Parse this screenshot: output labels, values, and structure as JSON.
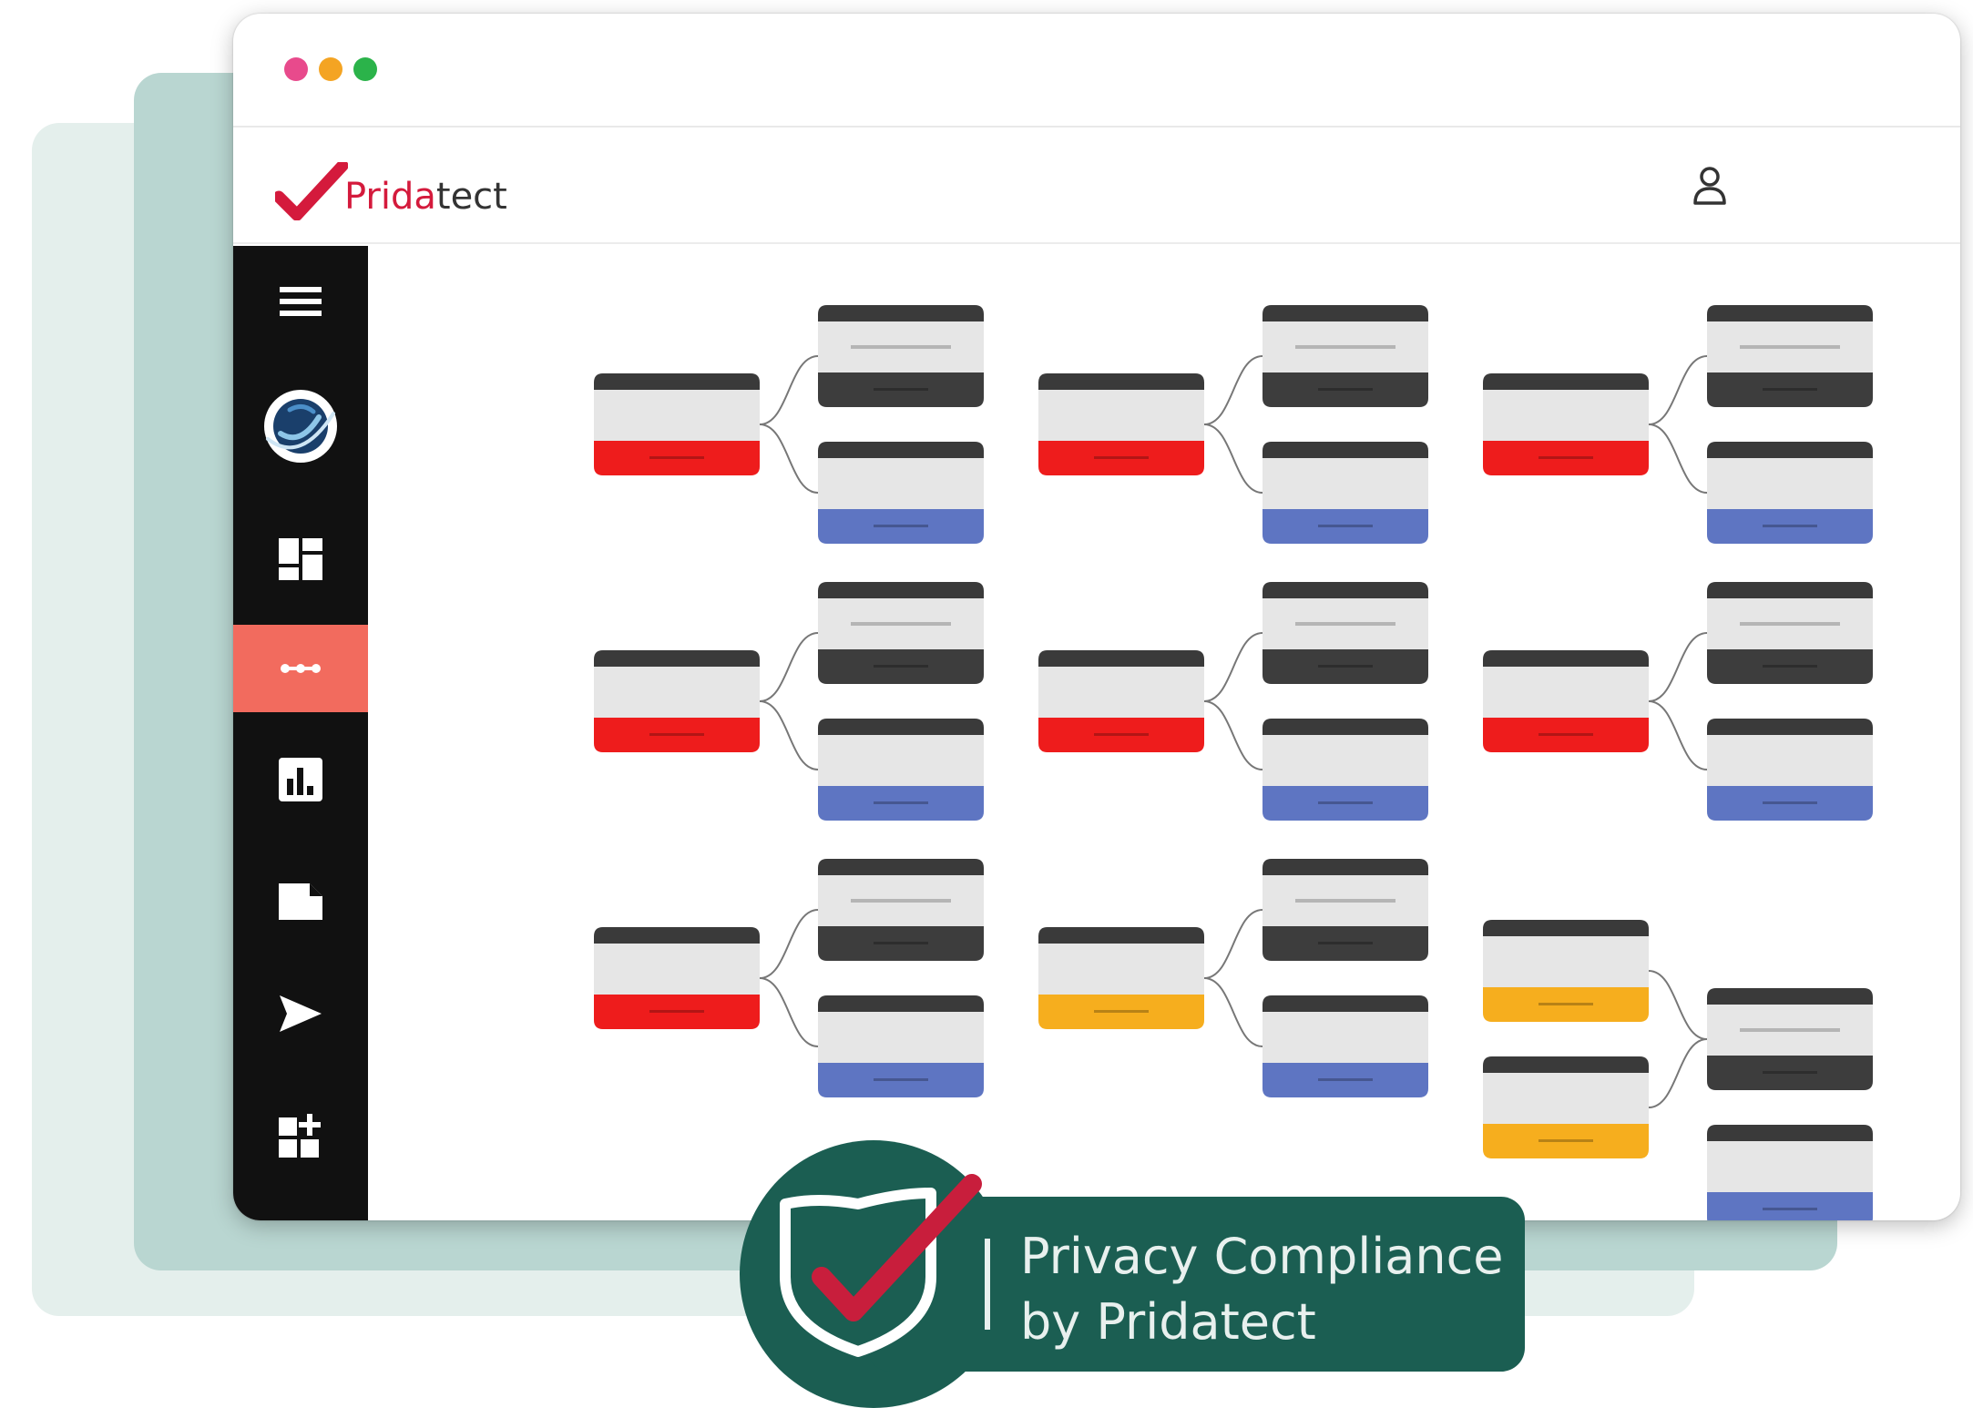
{
  "window": {
    "traffic_lights": [
      "#e84a8c",
      "#f4a423",
      "#2bb34a"
    ]
  },
  "app": {
    "logo_primary": "Prida",
    "logo_secondary": "tect",
    "user_icon": "user-icon",
    "brand_color": "#d41a3c"
  },
  "sidebar": {
    "items": [
      {
        "name": "menu",
        "icon": "hamburger-menu-icon"
      },
      {
        "name": "globe",
        "icon": "globe-logo-icon"
      },
      {
        "name": "dashboard",
        "icon": "dashboard-icon"
      },
      {
        "name": "workflows",
        "icon": "ellipsis-icon",
        "active": true
      },
      {
        "name": "reports",
        "icon": "bar-chart-icon"
      },
      {
        "name": "documents",
        "icon": "document-icon"
      },
      {
        "name": "send",
        "icon": "send-icon"
      },
      {
        "name": "add-widget",
        "icon": "add-widget-icon"
      }
    ],
    "active_color": "#f26b5e"
  },
  "flow_colors": {
    "header": "#3a3a3a",
    "body": "#e6e6e6",
    "red": "#ee1c1c",
    "blue": "#5e75c2",
    "yellow": "#f6ae1e",
    "dark": "#3d3d3d",
    "connector": "#777777"
  },
  "badge": {
    "line1": "Privacy Compliance",
    "line2": "by Pridatect",
    "background": "#1b5e52",
    "icon": "shield-check-icon"
  }
}
